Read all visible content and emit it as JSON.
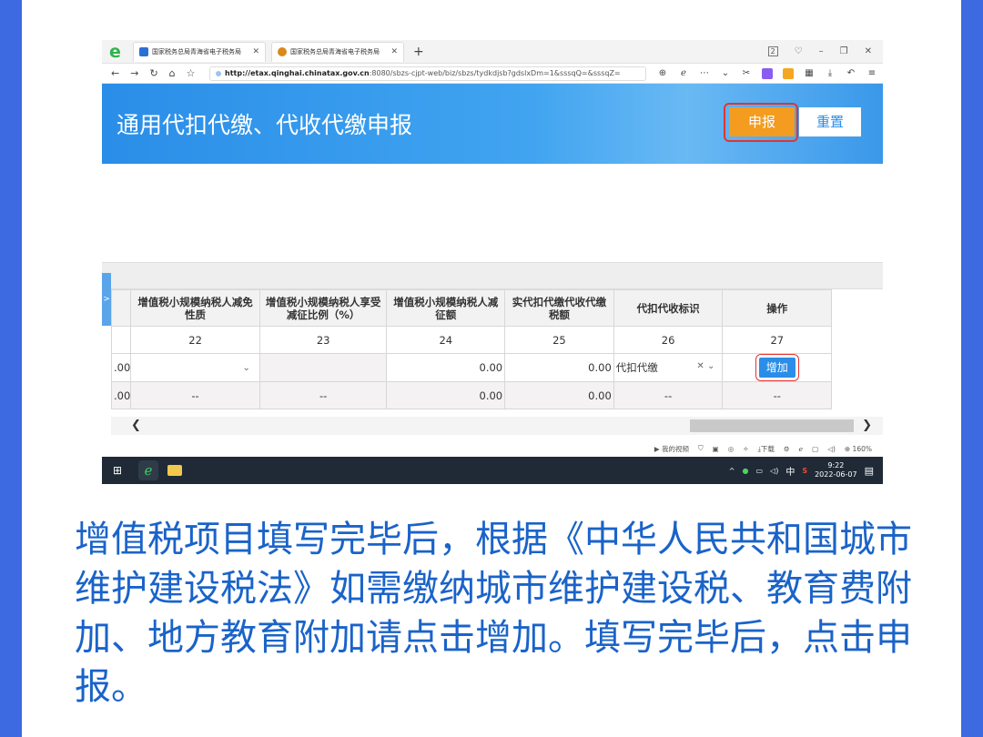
{
  "browser": {
    "tabs": [
      {
        "label": "国家税务总局青海省电子税务局"
      },
      {
        "label": "国家税务总局青海省电子税务局"
      }
    ],
    "new_tab": "+",
    "tab_count": "2",
    "url_host": "http://etax.qinghai.chinatax.gov.cn",
    "url_path": ":8080/sbzs-cjpt-web/biz/sbzs/tydkdjsb?gdslxDm=1&sssqQ=&sssqZ="
  },
  "page": {
    "title": "通用代扣代缴、代收代缴申报",
    "report_button": "申报",
    "reset_button": "重置"
  },
  "table": {
    "side_tab": ">",
    "headers": [
      "增值税小规模纳税人减免性质",
      "增值税小规模纳税人享受减征比例（%）",
      "增值税小规模纳税人减征额",
      "实代扣代缴代收代缴税额",
      "代扣代收标识",
      "操作"
    ],
    "numbers": [
      "22",
      "23",
      "24",
      "25",
      "26",
      "27"
    ],
    "rows": [
      {
        "lead": ".00",
        "c24": "0.00",
        "c25": "0.00",
        "tag": "代扣代缴",
        "action": "增加"
      },
      {
        "lead": ".00",
        "c22": "--",
        "c23": "--",
        "c24": "0.00",
        "c25": "0.00",
        "tag": "--",
        "action": "--"
      }
    ]
  },
  "statusbar": {
    "video": "我的视频",
    "download": "下载",
    "zoom": "160%"
  },
  "taskbar": {
    "ime": "中",
    "time": "9:22",
    "date": "2022-06-07"
  },
  "caption": "增值税项目填写完毕后，根据《中华人民共和国城市维护建设税法》如需缴纳城市维护建设税、教育费附加、地方教育附加请点击增加。填写完毕后，点击申报。"
}
